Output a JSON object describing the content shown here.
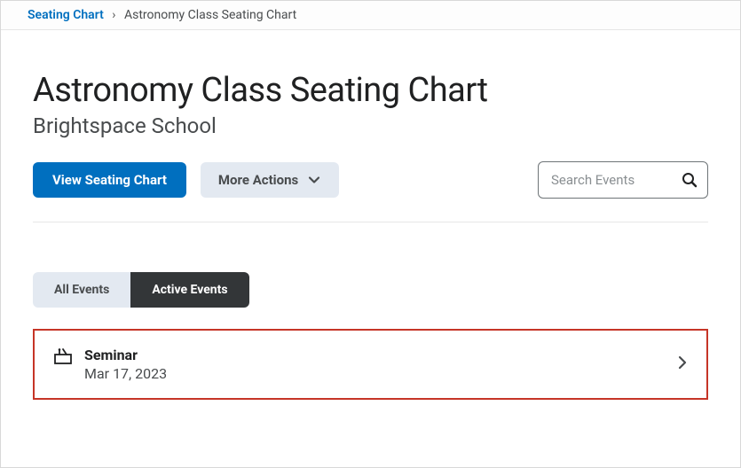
{
  "breadcrumb": {
    "parent": "Seating Chart",
    "current": "Astronomy Class Seating Chart"
  },
  "page": {
    "title": "Astronomy Class Seating Chart",
    "school": "Brightspace School"
  },
  "toolbar": {
    "view_chart_label": "View Seating Chart",
    "more_actions_label": "More Actions"
  },
  "search": {
    "placeholder": "Search Events"
  },
  "tabs": {
    "all": "All Events",
    "active": "Active Events"
  },
  "events": [
    {
      "title": "Seminar",
      "date": "Mar 17, 2023"
    }
  ]
}
